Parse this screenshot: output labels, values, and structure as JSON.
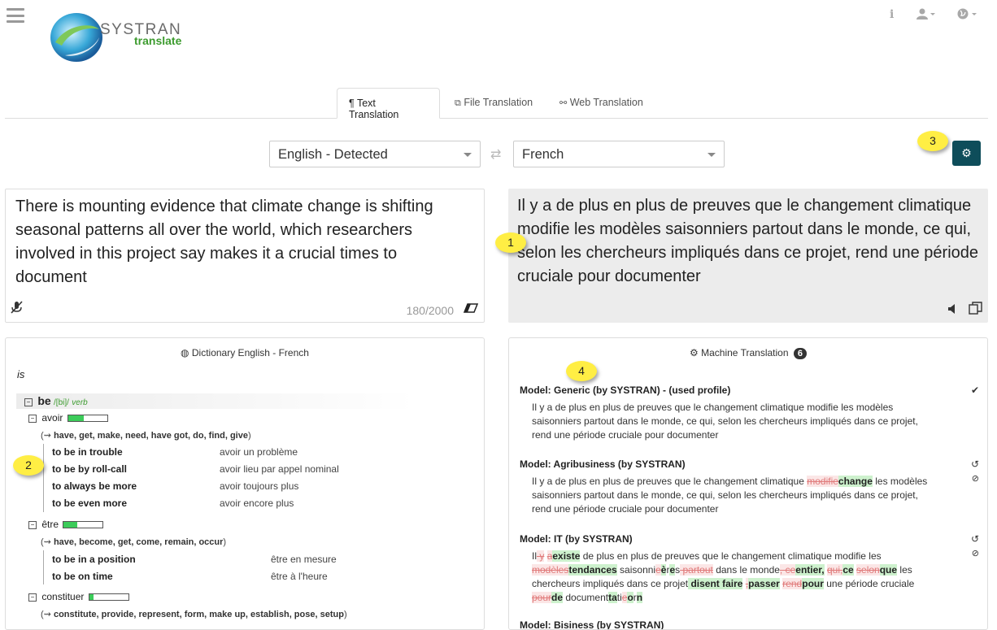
{
  "header": {
    "logo_name": "SYSTRAN",
    "logo_sub": "translate",
    "info_icon": "i",
    "user_icon": "user-icon",
    "lang_icon": "globe-icon"
  },
  "tabs": [
    {
      "label": "¶ Text Translation"
    },
    {
      "label": "File Translation"
    },
    {
      "label": "Web Translation"
    }
  ],
  "source_lang": "English - Detected",
  "target_lang": "French",
  "source_text": "There is mounting evidence that climate change is shifting seasonal patterns all over the world, which researchers involved in this project say makes it a crucial times to document",
  "char_counter": "180/2000",
  "target_text": "Il y a de plus en plus de preuves que le changement climatique modifie les modèles saisonniers partout dans le monde, ce qui, selon les chercheurs impliqués dans ce projet, rend une période cruciale pour documenter",
  "callouts": [
    "1",
    "2",
    "3",
    "4"
  ],
  "dictionary": {
    "title": "Dictionary English - French",
    "query": "is",
    "headword": "be",
    "pron": "/[bi]/",
    "pos": "verb",
    "senses": [
      {
        "label": "avoir",
        "strength": 0.4,
        "synonyms_prefix": "(",
        "synonyms": "have, get, make, need, have got, do, find, give",
        "phrases": [
          {
            "en": "to be in trouble",
            "fr": "avoir un problème"
          },
          {
            "en": "to be by roll-call",
            "fr": "avoir lieu par appel nominal"
          },
          {
            "en": "to always be more",
            "fr": "avoir toujours plus"
          },
          {
            "en": "to be even more",
            "fr": "avoir encore plus"
          }
        ]
      },
      {
        "label": "être",
        "strength": 0.35,
        "synonyms": "have, become, get, come, remain, occur",
        "phrases": [
          {
            "en": "to be in a position",
            "fr": "être en mesure"
          },
          {
            "en": "to be on time",
            "fr": "être à l'heure"
          }
        ]
      },
      {
        "label": "constituer",
        "strength": 0.1,
        "synonyms": "constitute, provide, represent, form, make up, establish, pose, setup"
      }
    ]
  },
  "mt": {
    "title": "Machine Translation",
    "count": "6",
    "models": [
      {
        "name": "Model: Generic (by SYSTRAN) - (used profile)"
      },
      {
        "name": "Model: Agribusiness (by SYSTRAN)"
      },
      {
        "name": "Model: IT (by SYSTRAN)"
      },
      {
        "name": "Model: Bisiness (by SYSTRAN)"
      }
    ],
    "generic_text": "Il y a de plus en plus de preuves que le changement climatique modifie les modèles saisonniers partout dans le monde, ce qui, selon les chercheurs impliqués dans ce projet, rend une période cruciale pour documenter",
    "agri": {
      "a": "Il y a de plus en plus de preuves que le changement climatique ",
      "del": "modifie",
      "ins": "change",
      "b": " les modèles saisonniers partout dans le monde, ce qui, selon les chercheurs impliqués dans ce projet, rend une période cruciale pour documenter"
    },
    "it": [
      {
        "t": "n",
        "v": "Il"
      },
      {
        "t": "d",
        "v": " y"
      },
      {
        "t": "n",
        "v": " "
      },
      {
        "t": "d",
        "v": "a"
      },
      {
        "t": "i",
        "v": "existe"
      },
      {
        "t": "n",
        "v": " de plus en plus de preuves que le changement climatique modifie les "
      },
      {
        "t": "d",
        "v": "modèles"
      },
      {
        "t": "i",
        "v": "tendances"
      },
      {
        "t": "n",
        "v": " saisonni"
      },
      {
        "t": "d",
        "v": "e"
      },
      {
        "t": "i",
        "v": "è"
      },
      {
        "t": "n",
        "v": "r"
      },
      {
        "t": "i",
        "v": "e"
      },
      {
        "t": "n",
        "v": "s"
      },
      {
        "t": "d",
        "v": " partout"
      },
      {
        "t": "n",
        "v": " dans le monde"
      },
      {
        "t": "d",
        "v": ", ce"
      },
      {
        "t": "i",
        "v": "entier,"
      },
      {
        "t": "n",
        "v": " "
      },
      {
        "t": "d",
        "v": "qui,"
      },
      {
        "t": "i",
        "v": "ce"
      },
      {
        "t": "n",
        "v": " "
      },
      {
        "t": "d",
        "v": "selon"
      },
      {
        "t": "i",
        "v": "que"
      },
      {
        "t": "n",
        "v": " les chercheurs impliqués dans ce projet"
      },
      {
        "t": "i",
        "v": " disent faire"
      },
      {
        "t": "n",
        "v": " "
      },
      {
        "t": "d",
        "v": ","
      },
      {
        "t": "i",
        "v": "passer"
      },
      {
        "t": "n",
        "v": " "
      },
      {
        "t": "d",
        "v": "rend"
      },
      {
        "t": "i",
        "v": "pour"
      },
      {
        "t": "n",
        "v": " une période cruciale "
      },
      {
        "t": "d",
        "v": "pour"
      },
      {
        "t": "i",
        "v": "de"
      },
      {
        "t": "n",
        "v": " document"
      },
      {
        "t": "i",
        "v": "ta"
      },
      {
        "t": "n",
        "v": "ti"
      },
      {
        "t": "d",
        "v": "e"
      },
      {
        "t": "i",
        "v": "o"
      },
      {
        "t": "n",
        "v": "r"
      },
      {
        "t": "i",
        "v": "n"
      }
    ]
  },
  "colors": {
    "accent": "#0e4d5a",
    "callout": "#ffee44",
    "insert": "#cdf1cd",
    "delete": "#e07a7a"
  }
}
